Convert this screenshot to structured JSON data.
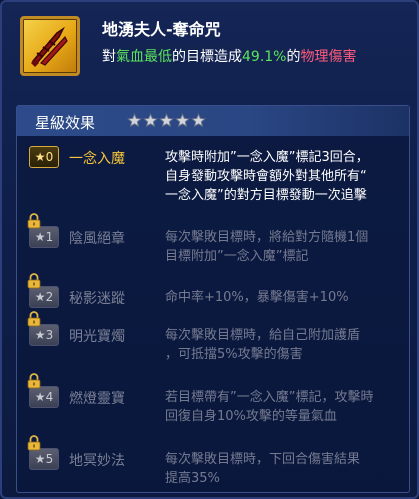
{
  "skill": {
    "icon": "crossed-blades-icon",
    "title": "地湧夫人-奪命咒",
    "desc_prefix": "對",
    "desc_target": "氣血最低",
    "desc_middle": "的目標造成",
    "desc_percent": "49.1%",
    "desc_of": "的",
    "desc_damage": "物理傷害"
  },
  "star_effects": {
    "title": "星級效果",
    "star_count": 5,
    "items": [
      {
        "level": "0",
        "name": "一念入魔",
        "locked": false,
        "lines": [
          "攻擊時附加”一念入魔”標記3回合，",
          "自身發動攻擊時會額外對其他所有“",
          "一念入魔”的對方目標發動一次追擊"
        ]
      },
      {
        "level": "1",
        "name": "陰風絕章",
        "locked": true,
        "lines": [
          "每次擊敗目標時，將給對方隨機1個",
          "目標附加”一念入魔”標記"
        ]
      },
      {
        "level": "2",
        "name": "秘影迷蹤",
        "locked": true,
        "lines": [
          "命中率+10%，暴擊傷害+10%"
        ]
      },
      {
        "level": "3",
        "name": "明光寶燭",
        "locked": true,
        "lines": [
          "每次擊敗目標時，給自己附加護盾",
          "，可抵擋5%攻擊的傷害"
        ]
      },
      {
        "level": "4",
        "name": "燃燈靈寶",
        "locked": true,
        "lines": [
          "若目標帶有”一念入魔”標記，攻擊時",
          "回復自身10%攻擊的等量氣血"
        ]
      },
      {
        "level": "5",
        "name": "地冥妙法",
        "locked": true,
        "lines": [
          "每次擊敗目標時，下回合傷害結果",
          "提高35%"
        ]
      }
    ]
  },
  "colors": {
    "gold": "#f7c63a",
    "green": "#5be35c",
    "red": "#ff5a7a",
    "locked_text": "#757a90"
  }
}
